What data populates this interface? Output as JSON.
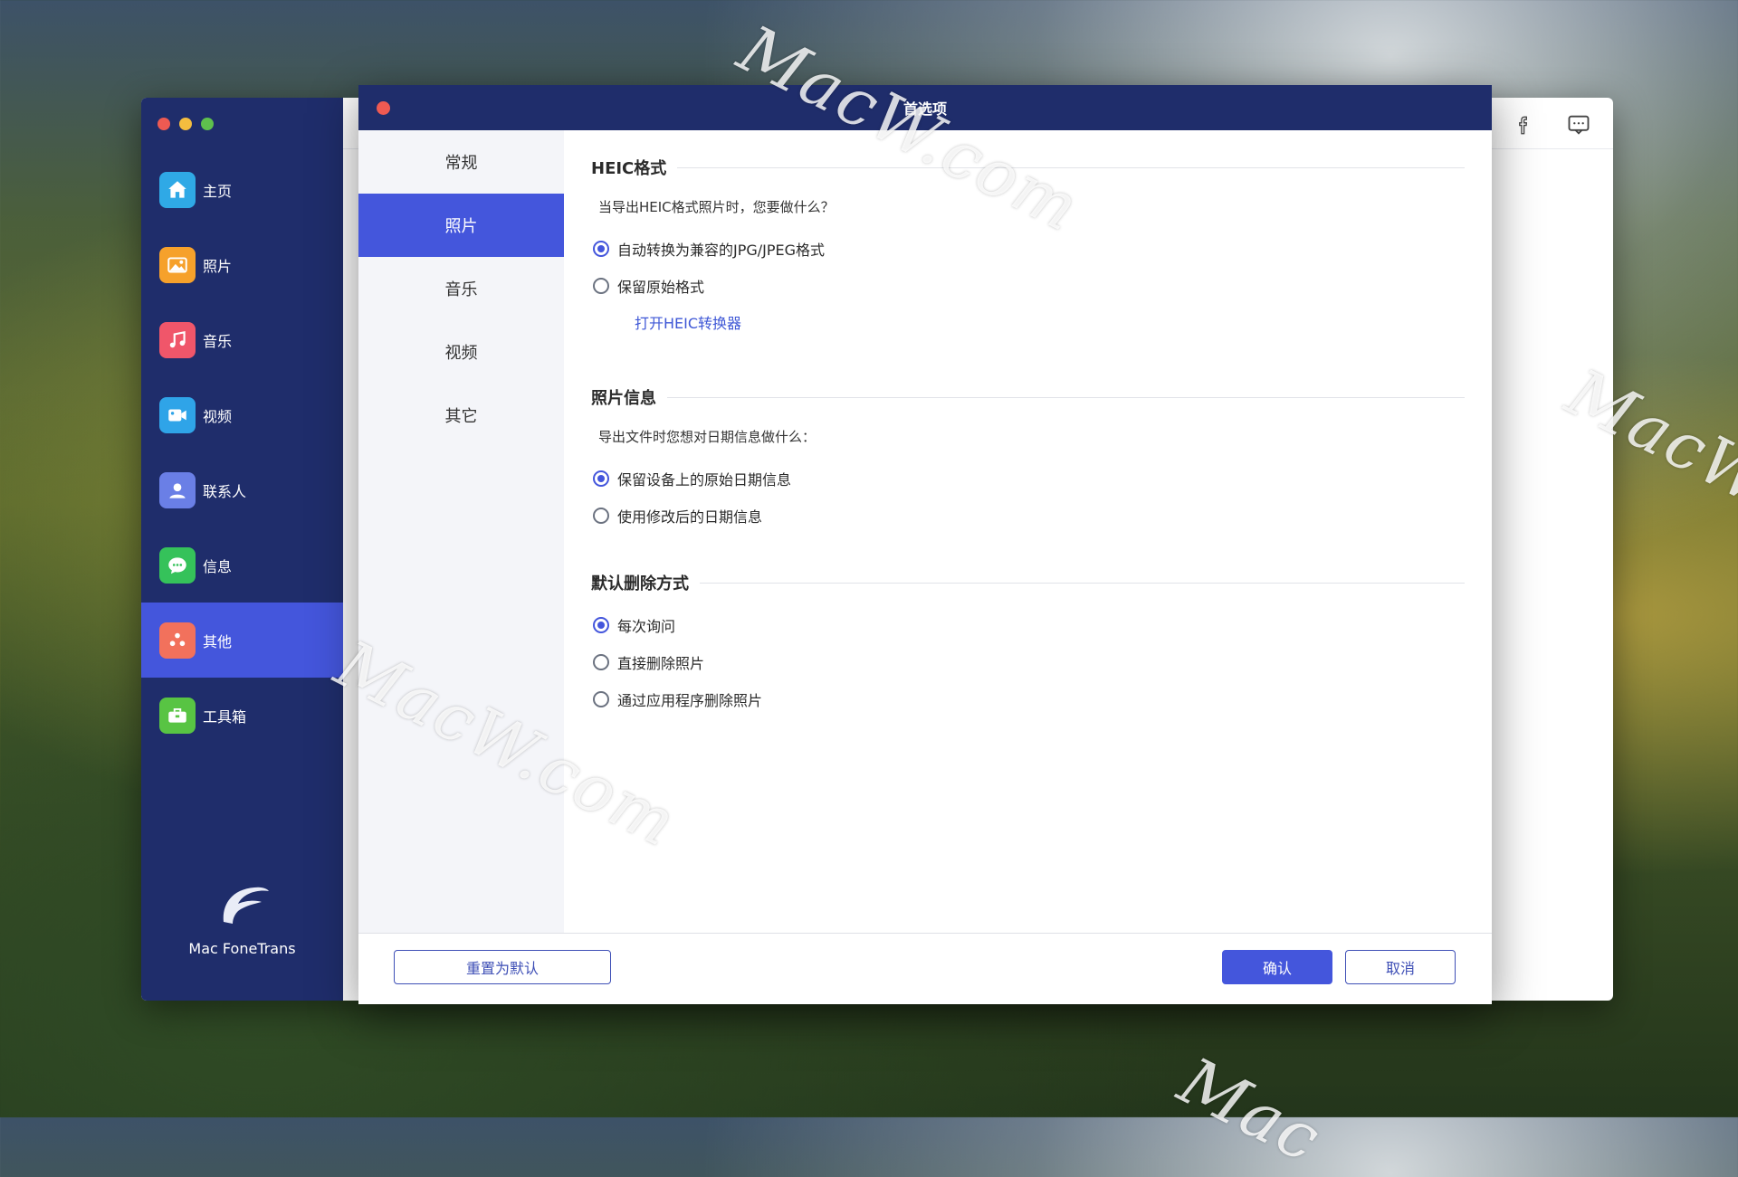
{
  "app": {
    "sidebar": {
      "items": [
        {
          "label": "主页",
          "icon": "home-icon",
          "color": "#2fa9e6"
        },
        {
          "label": "照片",
          "icon": "photo-icon",
          "color": "#f6a12b"
        },
        {
          "label": "音乐",
          "icon": "music-note-icon",
          "color": "#f0566a"
        },
        {
          "label": "视频",
          "icon": "video-camera-icon",
          "color": "#2fa4e8"
        },
        {
          "label": "联系人",
          "icon": "contact-icon",
          "color": "#6a7fe6"
        },
        {
          "label": "信息",
          "icon": "message-icon",
          "color": "#35c25a"
        },
        {
          "label": "其他",
          "icon": "apps-icon",
          "color": "#f2715c",
          "active": true
        },
        {
          "label": "工具箱",
          "icon": "toolbox-icon",
          "color": "#58c443"
        }
      ],
      "brand": "Mac FoneTrans"
    },
    "toolbar": {
      "facebook_icon": "facebook-icon",
      "feedback_icon": "feedback-icon"
    }
  },
  "dialog": {
    "title": "首选项",
    "tabs": [
      {
        "label": "常规"
      },
      {
        "label": "照片",
        "active": true
      },
      {
        "label": "音乐"
      },
      {
        "label": "视频"
      },
      {
        "label": "其它"
      }
    ],
    "heic": {
      "title": "HEIC格式",
      "question": "当导出HEIC格式照片时，您要做什么？",
      "options": [
        "自动转换为兼容的JPG/JPEG格式",
        "保留原始格式"
      ],
      "selected": 0,
      "link": "打开HEIC转换器"
    },
    "photo_info": {
      "title": "照片信息",
      "question": "导出文件时您想对日期信息做什么：",
      "options": [
        "保留设备上的原始日期信息",
        "使用修改后的日期信息"
      ],
      "selected": 0
    },
    "delete": {
      "title": "默认删除方式",
      "options": [
        "每次询问",
        "直接删除照片",
        "通过应用程序删除照片"
      ],
      "selected": 0
    },
    "footer": {
      "reset": "重置为默认",
      "ok": "确认",
      "cancel": "取消"
    }
  },
  "watermark": "MacW.com",
  "colors": {
    "navy": "#1f2d6b",
    "accent": "#4456dc"
  }
}
